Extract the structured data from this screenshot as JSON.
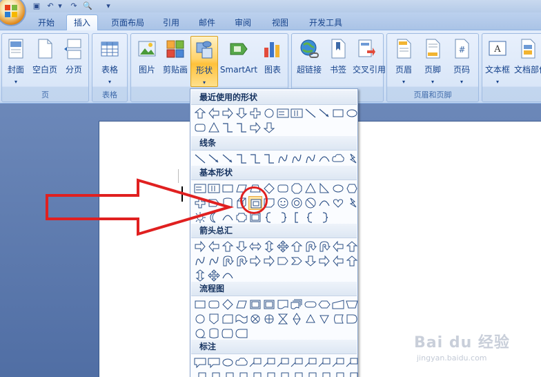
{
  "tabs": [
    "开始",
    "插入",
    "页面布局",
    "引用",
    "邮件",
    "审阅",
    "视图",
    "开发工具"
  ],
  "active_tab": "插入",
  "ribbon": {
    "pages_group": {
      "label": "页",
      "buttons": [
        "封面",
        "空白页",
        "分页"
      ]
    },
    "table_group": {
      "label": "表格",
      "buttons": [
        "表格"
      ]
    },
    "illustrations_group": {
      "buttons": [
        "图片",
        "剪贴画",
        "形状",
        "SmartArt",
        "图表"
      ]
    },
    "links_group": {
      "buttons": [
        "超链接",
        "书签",
        "交叉引用"
      ]
    },
    "header_footer_group": {
      "label": "页眉和页脚",
      "buttons": [
        "页眉",
        "页脚",
        "页码"
      ]
    },
    "text_group": {
      "buttons": [
        "文本框",
        "文档部件"
      ]
    }
  },
  "gallery": {
    "sections": [
      "最近使用的形状",
      "线条",
      "基本形状",
      "箭头总汇",
      "流程图",
      "标注"
    ]
  },
  "watermark": {
    "brand": "Bai du 经验",
    "url": "jingyan.baidu.com"
  },
  "colors": {
    "accent": "#ffc13b",
    "annotation": "#e02020",
    "ribbon": "#d6e4f7"
  },
  "icons": [
    "office-button",
    "save-icon",
    "undo-icon",
    "redo-icon",
    "print-preview-icon",
    "qat-dropdown-icon"
  ]
}
